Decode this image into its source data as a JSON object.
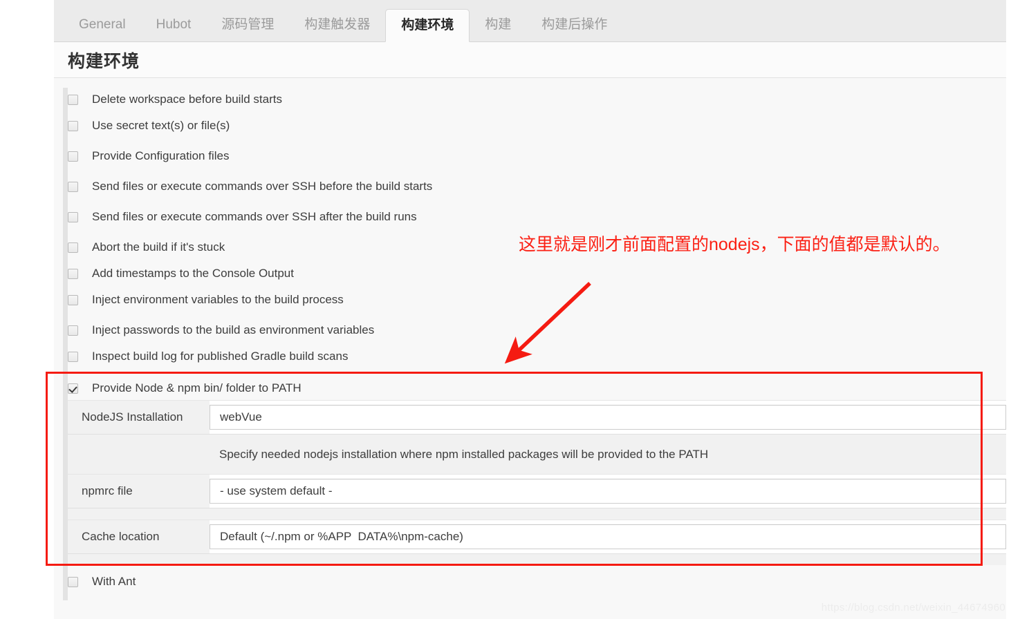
{
  "tabs": [
    {
      "label": "General",
      "active": false
    },
    {
      "label": "Hubot",
      "active": false
    },
    {
      "label": "源码管理",
      "active": false
    },
    {
      "label": "构建触发器",
      "active": false
    },
    {
      "label": "构建环境",
      "active": true
    },
    {
      "label": "构建",
      "active": false
    },
    {
      "label": "构建后操作",
      "active": false
    }
  ],
  "page": {
    "title": "构建环境"
  },
  "checkboxes_top": [
    {
      "label": "Delete workspace before build starts",
      "checked": false
    },
    {
      "label": "Use secret text(s) or file(s)",
      "checked": false
    },
    {
      "label": "Provide Configuration files",
      "checked": false
    },
    {
      "label": "Send files or execute commands over SSH before the build starts",
      "checked": false
    },
    {
      "label": "Send files or execute commands over SSH after the build runs",
      "checked": false
    },
    {
      "label": "Abort the build if it's stuck",
      "checked": false
    },
    {
      "label": "Add timestamps to the Console Output",
      "checked": false
    },
    {
      "label": "Inject environment variables to the build process",
      "checked": false
    },
    {
      "label": "Inject passwords to the build as environment variables",
      "checked": false
    },
    {
      "label": "Inspect build log for published Gradle build scans",
      "checked": false
    }
  ],
  "nodejs": {
    "header_label": "Provide Node & npm bin/ folder to PATH",
    "header_checked": true,
    "fields": [
      {
        "label": "NodeJS Installation",
        "value": "webVue"
      },
      {
        "label": "npmrc file",
        "value": "- use system default -"
      },
      {
        "label": "Cache location",
        "value": "Default (~/.npm or %APP  DATA%\\npm-cache)"
      }
    ],
    "help_text": "Specify needed nodejs installation where npm installed packages will be provided to the PATH"
  },
  "checkboxes_bottom": [
    {
      "label": "With Ant",
      "checked": false
    }
  ],
  "annotation": {
    "text": "这里就是刚才前面配置的nodejs，下面的值都是默认的。",
    "color": "#fb2014"
  },
  "watermark": {
    "text": "https://blog.csdn.net/weixin_44674960"
  }
}
